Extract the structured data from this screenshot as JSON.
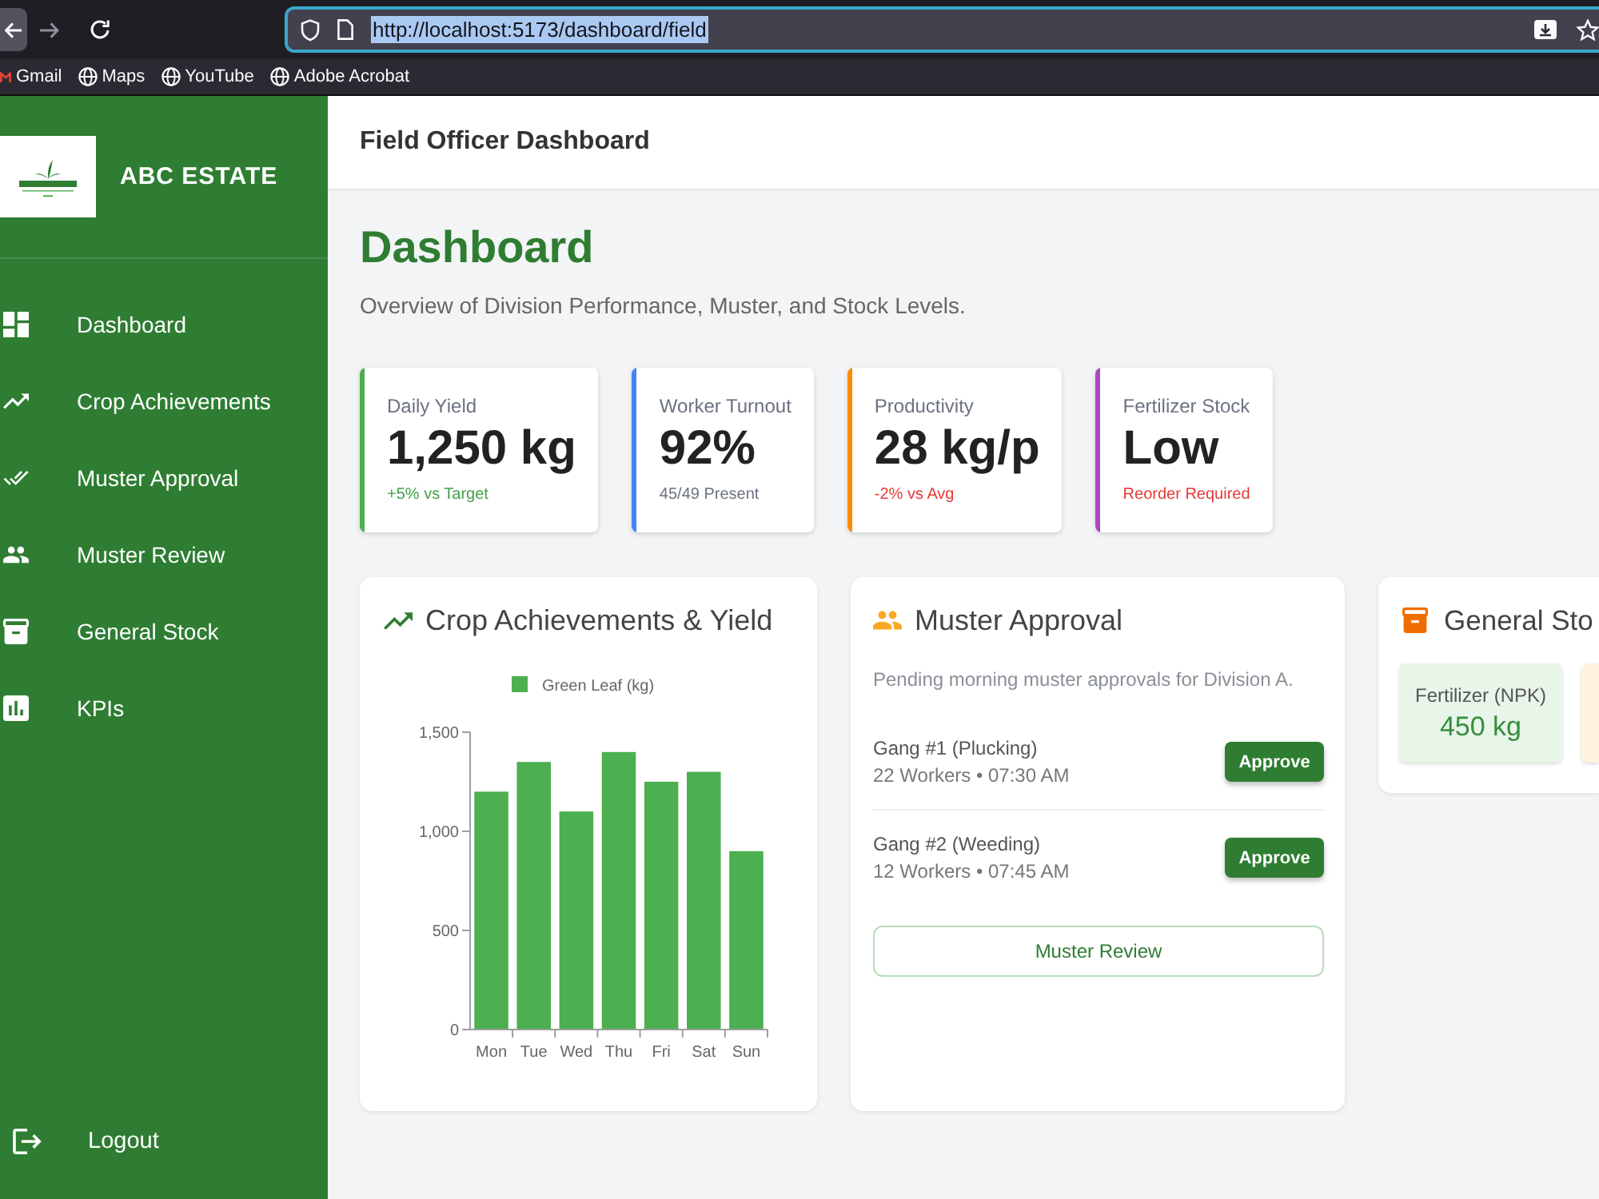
{
  "browser": {
    "url": "http://localhost:5173/dashboard/field",
    "url_selected": true,
    "bookmarks": [
      {
        "label": "Gmail"
      },
      {
        "label": "Maps"
      },
      {
        "label": "YouTube"
      },
      {
        "label": "Adobe Acrobat"
      }
    ]
  },
  "sidebar": {
    "brand": "ABC ESTATE",
    "items": [
      {
        "label": "Dashboard",
        "selected": false
      },
      {
        "label": "Crop Achievements",
        "selected": false
      },
      {
        "label": "Muster Approval",
        "selected": false
      },
      {
        "label": "Muster Review",
        "selected": false
      },
      {
        "label": "General Stock",
        "selected": false
      },
      {
        "label": "KPIs",
        "selected": false
      }
    ],
    "logout": "Logout"
  },
  "header": {
    "title": "Field Officer Dashboard"
  },
  "page": {
    "title": "Dashboard",
    "subtitle": "Overview of Division Performance, Muster, and Stock Levels."
  },
  "stats": [
    {
      "label": "Daily Yield",
      "value": "1,250 kg",
      "note": "+5% vs Target",
      "kind": "positive",
      "color": "#4caf50"
    },
    {
      "label": "Worker Turnout",
      "value": "92%",
      "note": "45/49 Present",
      "kind": "neutral",
      "color": "#4285f4"
    },
    {
      "label": "Productivity",
      "value": "28 kg/p",
      "note": "-2% vs Avg",
      "kind": "negative",
      "color": "#fb8c00"
    },
    {
      "label": "Fertilizer Stock",
      "value": "Low",
      "note": "Reorder Required",
      "kind": "negative",
      "color": "#ab47bc"
    }
  ],
  "crop_card": {
    "title": "Crop Achievements & Yield",
    "chart_data": {
      "type": "bar",
      "categories": [
        "Mon",
        "Tue",
        "Wed",
        "Thu",
        "Fri",
        "Sat",
        "Sun"
      ],
      "series": [
        {
          "name": "Green Leaf (kg)",
          "color": "#4caf50",
          "values": [
            1200,
            1350,
            1100,
            1400,
            1250,
            1300,
            900
          ]
        }
      ],
      "ylim": [
        0,
        1500
      ],
      "yticks": [
        {
          "value": 0,
          "label": "0"
        },
        {
          "value": 500,
          "label": "500"
        },
        {
          "value": 1000,
          "label": "1,000"
        },
        {
          "value": 1500,
          "label": "1,500"
        }
      ]
    }
  },
  "muster_card": {
    "title": "Muster Approval",
    "description": "Pending morning muster approvals for Division A.",
    "gangs": [
      {
        "name": "Gang #1 (Plucking)",
        "details": "22 Workers • 07:30 AM",
        "action": "Approve"
      },
      {
        "name": "Gang #2 (Weeding)",
        "details": "12 Workers • 07:45 AM",
        "action": "Approve"
      }
    ],
    "review_button": "Muster Review"
  },
  "stock_card": {
    "title": "General Sto",
    "items": [
      {
        "label": "Fertilizer (NPK)",
        "value": "450 kg",
        "color": "#e8f5e9"
      },
      {
        "color": "#fff3e0"
      }
    ]
  }
}
